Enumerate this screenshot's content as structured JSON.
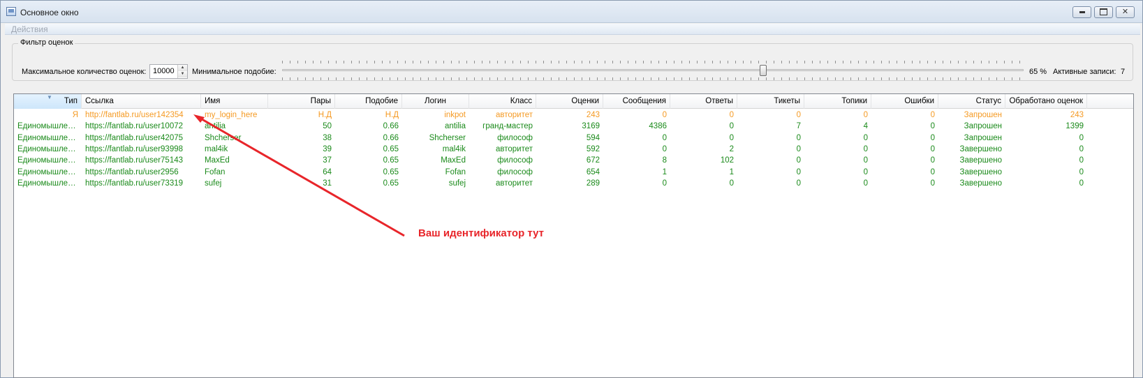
{
  "window": {
    "title": "Основное окно"
  },
  "menu": {
    "actions": "Действия"
  },
  "filter": {
    "group_title": "Фильтр оценок",
    "max_label": "Максимальное количество оценок:",
    "max_value": "10000",
    "min_label": "Минимальное  подобие:",
    "slider_percent": 65,
    "percent_text": "65 %",
    "active_label": "Активные записи:",
    "active_count": "7"
  },
  "colors": {
    "self_row": "#f59a23",
    "other_rows": "#1a8a1a",
    "annotation": "#e8252a"
  },
  "table": {
    "columns": [
      "Тип",
      "Ссылка",
      "Имя",
      "Пары",
      "Подобие",
      "Логин",
      "Класс",
      "Оценки",
      "Сообщения",
      "Ответы",
      "Тикеты",
      "Топики",
      "Ошибки",
      "Статус",
      "Обработано оценок"
    ],
    "rows": [
      [
        "Я",
        "http://fantlab.ru/user142354",
        "my_login_here",
        "Н.Д",
        "Н.Д",
        "inkpot",
        "авторитет",
        "243",
        "0",
        "0",
        "0",
        "0",
        "0",
        "Запрошен",
        "243"
      ],
      [
        "Единомышлен...",
        "https://fantlab.ru/user10072",
        "antilia",
        "50",
        "0.66",
        "antilia",
        "гранд-мастер",
        "3169",
        "4386",
        "0",
        "7",
        "4",
        "0",
        "Запрошен",
        "1399"
      ],
      [
        "Единомышлен...",
        "https://fantlab.ru/user42075",
        "Shcherser",
        "38",
        "0.66",
        "Shcherser",
        "философ",
        "594",
        "0",
        "0",
        "0",
        "0",
        "0",
        "Запрошен",
        "0"
      ],
      [
        "Единомышлен...",
        "https://fantlab.ru/user93998",
        "mal4ik",
        "39",
        "0.65",
        "mal4ik",
        "авторитет",
        "592",
        "0",
        "2",
        "0",
        "0",
        "0",
        "Завершено",
        "0"
      ],
      [
        "Единомышлен...",
        "https://fantlab.ru/user75143",
        "MaxEd",
        "37",
        "0.65",
        "MaxEd",
        "философ",
        "672",
        "8",
        "102",
        "0",
        "0",
        "0",
        "Завершено",
        "0"
      ],
      [
        "Единомышлен...",
        "https://fantlab.ru/user2956",
        "Fofan",
        "64",
        "0.65",
        "Fofan",
        "философ",
        "654",
        "1",
        "1",
        "0",
        "0",
        "0",
        "Завершено",
        "0"
      ],
      [
        "Единомышлен...",
        "https://fantlab.ru/user73319",
        "sufej",
        "31",
        "0.65",
        "sufej",
        "авторитет",
        "289",
        "0",
        "0",
        "0",
        "0",
        "0",
        "Завершено",
        "0"
      ]
    ]
  },
  "annotation": {
    "text": "Ваш идентификатор тут"
  }
}
